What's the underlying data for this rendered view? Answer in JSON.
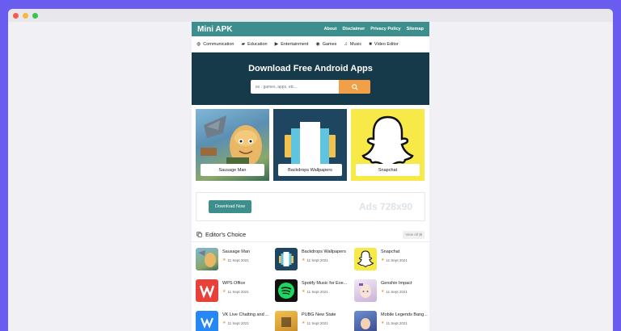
{
  "nav": {
    "brand": "Mini APK",
    "links": [
      "About",
      "Disclaimer",
      "Privacy Policy",
      "Sitemap"
    ]
  },
  "categories": [
    {
      "icon": "globe-icon",
      "label": "Communication"
    },
    {
      "icon": "graduation-cap-icon",
      "label": "Education"
    },
    {
      "icon": "video-icon",
      "label": "Entertainment"
    },
    {
      "icon": "gamepad-icon",
      "label": "Games"
    },
    {
      "icon": "music-icon",
      "label": "Music"
    },
    {
      "icon": "camera-icon",
      "label": "Video Editor"
    }
  ],
  "hero": {
    "title": "Download Free Android Apps",
    "search_placeholder": "ex : games, apps, etc..."
  },
  "featured": [
    "Sausage Man",
    "Backdrops Wallpapers",
    "Snapchat"
  ],
  "ad": {
    "button": "Download Now",
    "text": "Ads 728x90"
  },
  "editors_choice": {
    "title": "Editor's Choice",
    "view_all": "View All",
    "items": [
      {
        "name": "Sausage Man",
        "date": "11 Sept 2021"
      },
      {
        "name": "Backdrops Wallpapers",
        "date": "11 Sept 2021"
      },
      {
        "name": "Snapchat",
        "date": "11 Sept 2021"
      },
      {
        "name": "WPS Office",
        "date": "11 Sept 2021"
      },
      {
        "name": "Spotify Music for Eve...",
        "date": "11 Sept 2021"
      },
      {
        "name": "Genshin Impact",
        "date": "11 Sept 2021"
      },
      {
        "name": "VK Live Chatting and ...",
        "date": "11 Sept 2021"
      },
      {
        "name": "PUBG New State",
        "date": "11 Sept 2021"
      },
      {
        "name": "Mobile Legends Bang...",
        "date": "11 Sept 2021"
      }
    ]
  },
  "colors": {
    "accent": "#3d8f8e",
    "hero_bg": "#173a4a",
    "search_button": "#f1a048",
    "frame": "#6b5cf0"
  }
}
